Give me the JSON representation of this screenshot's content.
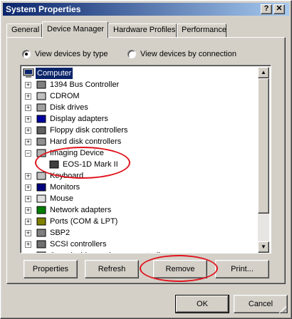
{
  "window": {
    "title": "System Properties",
    "help_button": "?",
    "close_button": "✕"
  },
  "tabs": [
    "General",
    "Device Manager",
    "Hardware Profiles",
    "Performance"
  ],
  "view": {
    "by_type": "View devices by type",
    "by_connection": "View devices by connection",
    "selected": "by_type"
  },
  "tree": {
    "root": "Computer",
    "items": [
      {
        "label": "1394 Bus Controller",
        "icon": "bus-controller-icon"
      },
      {
        "label": "CDROM",
        "icon": "cdrom-icon"
      },
      {
        "label": "Disk drives",
        "icon": "disk-drive-icon"
      },
      {
        "label": "Display adapters",
        "icon": "display-adapter-icon"
      },
      {
        "label": "Floppy disk controllers",
        "icon": "floppy-controller-icon"
      },
      {
        "label": "Hard disk controllers",
        "icon": "hard-disk-controller-icon"
      },
      {
        "label": "Imaging Device",
        "icon": "imaging-device-icon",
        "expanded": true,
        "children": [
          {
            "label": "EOS-1D Mark II",
            "icon": "camera-icon"
          }
        ]
      },
      {
        "label": "Keyboard",
        "icon": "keyboard-icon"
      },
      {
        "label": "Monitors",
        "icon": "monitor-icon"
      },
      {
        "label": "Mouse",
        "icon": "mouse-icon"
      },
      {
        "label": "Network adapters",
        "icon": "network-adapter-icon"
      },
      {
        "label": "Ports (COM & LPT)",
        "icon": "ports-icon"
      },
      {
        "label": "SBP2",
        "icon": "sbp2-icon"
      },
      {
        "label": "SCSI controllers",
        "icon": "scsi-icon"
      },
      {
        "label": "Sound, video and game controllers",
        "icon": "sound-icon"
      }
    ]
  },
  "buttons": {
    "properties": "Properties",
    "refresh": "Refresh",
    "remove": "Remove",
    "print": "Print...",
    "ok": "OK",
    "cancel": "Cancel"
  },
  "colors": {
    "face": "#d4d0c8",
    "title_start": "#0a246a",
    "title_end": "#a6caf0",
    "selection": "#0a246a",
    "annotation_red": "#e0141e"
  }
}
